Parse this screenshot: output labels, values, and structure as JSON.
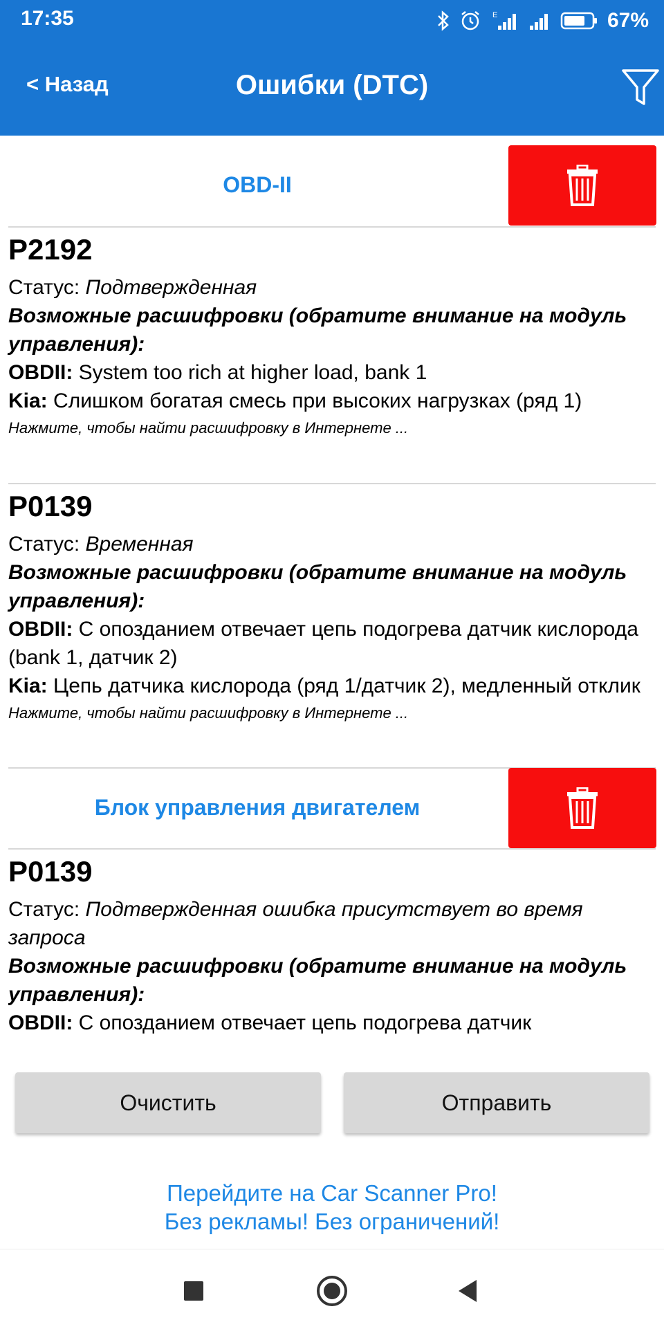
{
  "status_bar": {
    "time": "17:35",
    "battery": "67%"
  },
  "appbar": {
    "back_label": "< Назад",
    "title": "Ошибки (DTC)"
  },
  "sections": [
    {
      "title": "OBD-II"
    },
    {
      "title": "Блок управления двигателем"
    }
  ],
  "dtcs": [
    {
      "code": "P2192",
      "status_label": "Статус: ",
      "status_value": "Подтвержденная",
      "hint": "Возможные расшифровки (обратите внимание на модуль управления):",
      "rows": [
        {
          "brand": "OBDII:",
          "text": " System too rich at higher load, bank 1"
        },
        {
          "brand": "Kia:",
          "text": " Слишком богатая смесь при высоких нагрузках (ряд 1)"
        }
      ],
      "search": "Нажмите, чтобы найти расшифровку в Интернете ..."
    },
    {
      "code": "P0139",
      "status_label": "Статус: ",
      "status_value": "Временная",
      "hint": "Возможные расшифровки (обратите внимание на модуль управления):",
      "rows": [
        {
          "brand": "OBDII:",
          "text": " С опозданием отвечает цепь подогрева датчик кислорода (bank 1, датчик 2)"
        },
        {
          "brand": "Kia:",
          "text": " Цепь датчика кислорода (ряд 1/датчик 2), медленный отклик"
        }
      ],
      "search": "Нажмите, чтобы найти расшифровку в Интернете ..."
    },
    {
      "code": "P0139",
      "status_label": "Статус: ",
      "status_value": "Подтвержденная ошибка присутствует во время запроса",
      "hint": "Возможные расшифровки (обратите внимание на модуль управления):",
      "rows": [
        {
          "brand": "OBDII:",
          "text": " С опозданием отвечает цепь подогрева датчик"
        }
      ]
    }
  ],
  "buttons": {
    "clear": "Очистить",
    "send": "Отправить"
  },
  "promo": {
    "line1": "Перейдите на Car Scanner Pro!",
    "line2": "Без рекламы! Без ограничений!"
  },
  "colors": {
    "appbar": "#1976d2",
    "accent": "#1e88e5",
    "delete": "#f70e0e",
    "button": "#d8d8d8"
  },
  "icons": [
    "bluetooth-icon",
    "alarm-icon",
    "signal-icon",
    "battery-icon",
    "filter-icon",
    "trash-icon",
    "nav-recents-icon",
    "nav-home-icon",
    "nav-back-icon"
  ]
}
